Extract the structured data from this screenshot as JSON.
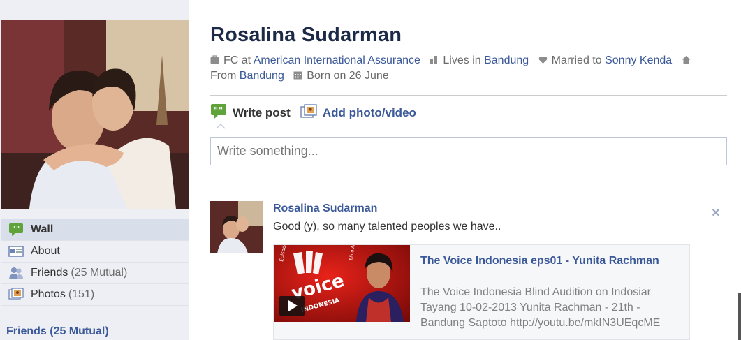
{
  "profile": {
    "name": "Rosalina Sudarman"
  },
  "info": {
    "work_prefix": "FC at",
    "work_place": "American International Assurance",
    "lives_prefix": "Lives in",
    "lives_place": "Bandung",
    "married_prefix": "Married to",
    "married_name": "Sonny Kenda",
    "from_prefix": "From",
    "from_place": "Bandung",
    "born": "Born on 26 June"
  },
  "sidebar": {
    "items": [
      {
        "label": "Wall",
        "count": "",
        "icon": "wall-icon",
        "active": true
      },
      {
        "label": "About",
        "count": "",
        "icon": "about-icon",
        "active": false
      },
      {
        "label": "Friends",
        "count": "(25 Mutual)",
        "icon": "friends-icon",
        "active": false
      },
      {
        "label": "Photos",
        "count": "(151)",
        "icon": "photos-icon",
        "active": false
      }
    ],
    "friends_header": "Friends (25 Mutual)"
  },
  "composer": {
    "write_label": "Write post",
    "photo_label": "Add photo/video",
    "placeholder": "Write something..."
  },
  "story": {
    "author": "Rosalina Sudarman",
    "text": "Good (y), so many talented peoples we have..",
    "close": "×",
    "attachment": {
      "title": "The Voice Indonesia eps01 - Yunita Rachman",
      "description": "The Voice Indonesia Blind Audition on Indosiar Tayang 10-02-2013 Yunita Rachman - 21th - Bandung Saptoto http://youtu.be/mkIN3UEqcME",
      "thumb_text_top": "Episode 1",
      "thumb_text_small": "Blind Audition",
      "thumb_logo_main": "voice",
      "thumb_logo_sub": "INDONESIA"
    }
  },
  "colors": {
    "link": "#3b5998",
    "title": "#1c2a47",
    "sidebar_bg": "#edeff4",
    "active_nav": "#d8dfea"
  }
}
